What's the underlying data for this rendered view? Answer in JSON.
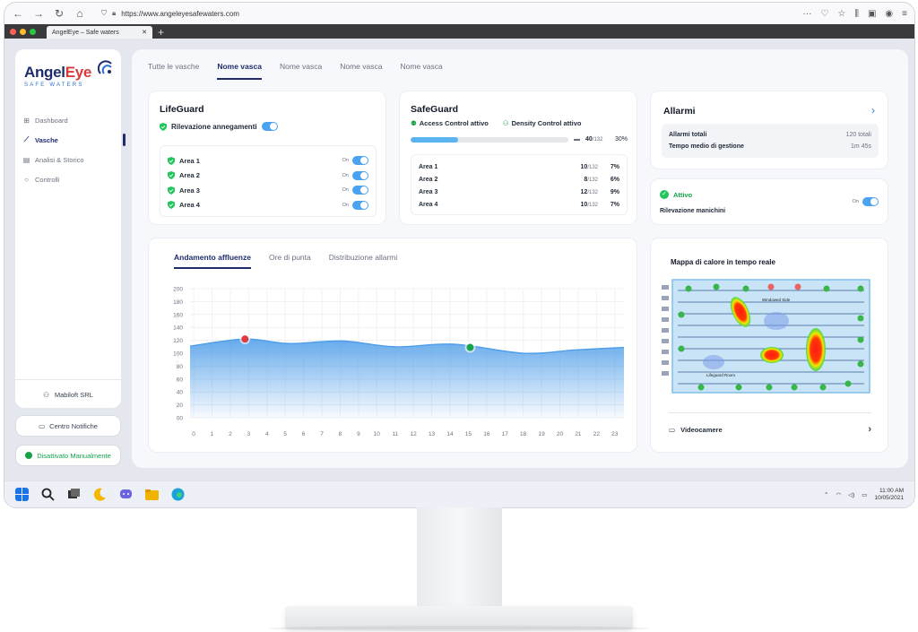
{
  "browser": {
    "url": "https://www.angeleyesafewaters.com",
    "tab_title": "AngelEye – Safe waters"
  },
  "brand": {
    "name_a": "Angel",
    "name_b": "Eye",
    "tagline": "SAFE WATERS",
    "colors": {
      "navy": "#1e2c6b",
      "accent": "#2b6fd4",
      "success": "#16a34a",
      "alert": "#e23b3b"
    }
  },
  "sidebar": {
    "items": [
      {
        "label": "Dashboard",
        "icon": "grid-icon"
      },
      {
        "label": "Vasche",
        "icon": "chart-icon"
      },
      {
        "label": "Analisi & Storico",
        "icon": "document-icon"
      },
      {
        "label": "Controlli",
        "icon": "circle-icon"
      }
    ],
    "company": "Mabiloft SRL",
    "notif_button": "Centro Notifiche",
    "status_button": "Disattivato Manualmente"
  },
  "main_tabs": [
    "Tutte le vasche",
    "Nome vasca",
    "Nome vasca",
    "Nome vasca",
    "Nome vasca"
  ],
  "lifeguard": {
    "title": "LifeGuard",
    "detection_label": "Rilevazione annegamenti",
    "on_label": "On",
    "areas": [
      "Area 1",
      "Area 2",
      "Area 3",
      "Area 4"
    ]
  },
  "safeguard": {
    "title": "SafeGuard",
    "access_label": "Access Control attivo",
    "density_label": "Density Control attivo",
    "occupancy": 40,
    "capacity_label": "/132",
    "occupancy_label": "40",
    "percent_label": "30%",
    "percent": 30,
    "areas": [
      {
        "label": "Area 1",
        "count": "10",
        "pct": "7%"
      },
      {
        "label": "Area 2",
        "count": "8",
        "pct": "6%"
      },
      {
        "label": "Area 3",
        "count": "12",
        "pct": "9%"
      },
      {
        "label": "Area 4",
        "count": "10",
        "pct": "7%"
      }
    ]
  },
  "alarms": {
    "title": "Allarmi",
    "total_label": "Allarmi totali",
    "total_value": "120 totali",
    "avg_label": "Tempo medio di gestione",
    "avg_value": "1m 45s"
  },
  "mannequin": {
    "status": "Attivo",
    "label": "Rilevazione manichini",
    "on_label": "On"
  },
  "chart_tabs": [
    "Andamento affluenze",
    "Ore di punta",
    "Distribuzione allarmi"
  ],
  "chart_data": {
    "type": "area",
    "x": [
      0,
      1,
      2,
      3,
      4,
      5,
      6,
      7,
      8,
      9,
      10,
      11,
      12,
      13,
      14,
      15,
      16,
      17,
      18,
      19,
      20,
      21,
      22,
      23
    ],
    "y_ticks": [
      "00",
      "20",
      "40",
      "60",
      "80",
      "100",
      "120",
      "140",
      "160",
      "180",
      "200"
    ],
    "ylim": [
      0,
      200
    ],
    "xlim": [
      -0.2,
      23.5
    ],
    "series": [
      {
        "points": [
          [
            -0.2,
            111
          ],
          [
            2.8,
            122
          ],
          [
            5.2,
            115
          ],
          [
            8.1,
            119
          ],
          [
            11,
            110
          ],
          [
            14.2,
            114
          ],
          [
            18,
            100
          ],
          [
            20.8,
            105
          ],
          [
            23.5,
            109
          ]
        ]
      }
    ],
    "markers": [
      {
        "x": 2.8,
        "y": 122,
        "color": "#e23b3b"
      },
      {
        "x": 15.1,
        "y": 109,
        "color": "#16a34a"
      }
    ],
    "grid": true,
    "line_color": "#4a9be8"
  },
  "heatmap": {
    "title": "Mappa di calore in tempo reale",
    "label_window": "Windowed Side",
    "label_room": "Lifeguard Room",
    "camera_label": "Videocamere"
  },
  "taskbar": {
    "time": "11:00 AM",
    "date": "10/05/2021"
  }
}
